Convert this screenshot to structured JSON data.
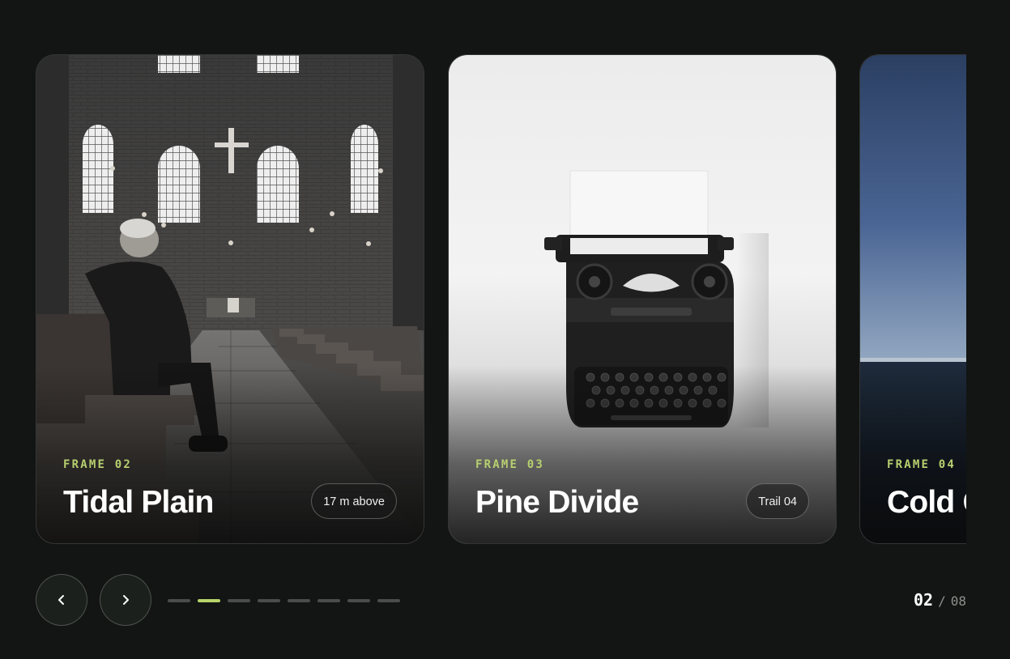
{
  "carousel": {
    "cards": [
      {
        "frame": "FRAME 02",
        "title": "Tidal Plain",
        "badge": "17 m above",
        "image": "church-interior-man-in-pew"
      },
      {
        "frame": "FRAME 03",
        "title": "Pine Divide",
        "badge": "Trail 04",
        "image": "vintage-typewriter-on-white"
      },
      {
        "frame": "FRAME 04",
        "title": "Cold C",
        "image": "sea-horizon-blue-sky"
      }
    ],
    "active_index": 1,
    "dot_count": 8
  },
  "controls": {
    "prev_icon": "chevron-left-icon",
    "next_icon": "chevron-right-icon"
  },
  "counter": {
    "current": "02",
    "separator": "/",
    "total": "08"
  },
  "colors": {
    "background": "#121513",
    "accent": "#b7d36a",
    "frame_label": "#b7cf6f"
  }
}
